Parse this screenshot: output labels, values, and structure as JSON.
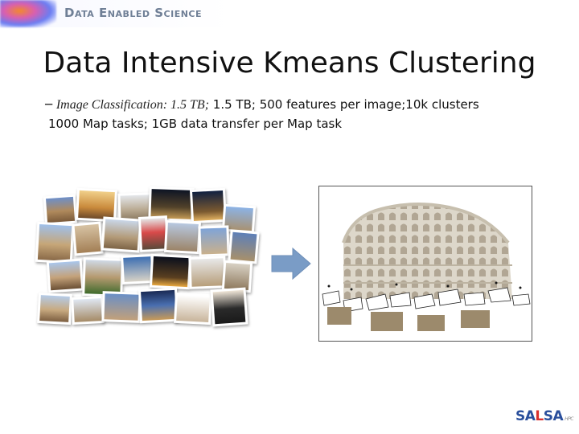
{
  "banner": {
    "text": "Data Enabled Science"
  },
  "slide": {
    "title": "Data Intensive Kmeans Clustering",
    "bullet_dash": "─",
    "bullet_italic": "Image Classification: 1.5 TB;",
    "bullet_rest": " 1.5 TB; 500 features per image;10k clusters",
    "subline": "1000 Map tasks; 1GB data transfer per Map task"
  },
  "figure": {
    "left_image": "photo-collage-of-colosseum",
    "right_image": "3d-reconstruction-of-colosseum",
    "arrow_icon": "right-arrow-icon",
    "arrow_color": "#7a9cc6"
  },
  "logo": {
    "part1": "SA",
    "part2": "L",
    "part3": "SA",
    "small": "HPC"
  }
}
